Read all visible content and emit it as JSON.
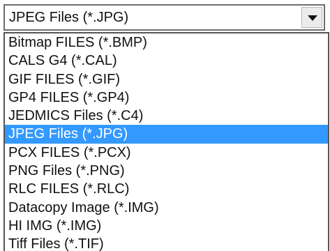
{
  "combo": {
    "selected": "JPEG Files (*.JPG)",
    "button_icon": "chevron-down-icon"
  },
  "dropdown": {
    "selected_color": "#3399ff",
    "options": [
      {
        "label": "Bitmap FILES (*.BMP)",
        "selected": false
      },
      {
        "label": "CALS G4 (*.CAL)",
        "selected": false
      },
      {
        "label": "GIF FILES (*.GIF)",
        "selected": false
      },
      {
        "label": "GP4 FILES (*.GP4)",
        "selected": false
      },
      {
        "label": "JEDMICS Files (*.C4)",
        "selected": false
      },
      {
        "label": "JPEG Files (*.JPG)",
        "selected": true
      },
      {
        "label": "PCX FILES (*.PCX)",
        "selected": false
      },
      {
        "label": "PNG Files (*.PNG)",
        "selected": false
      },
      {
        "label": "RLC FILES (*.RLC)",
        "selected": false
      },
      {
        "label": "Datacopy Image (*.IMG)",
        "selected": false
      },
      {
        "label": "HI IMG (*.IMG)",
        "selected": false
      },
      {
        "label": "Tiff Files (*.TIF)",
        "selected": false
      }
    ]
  }
}
